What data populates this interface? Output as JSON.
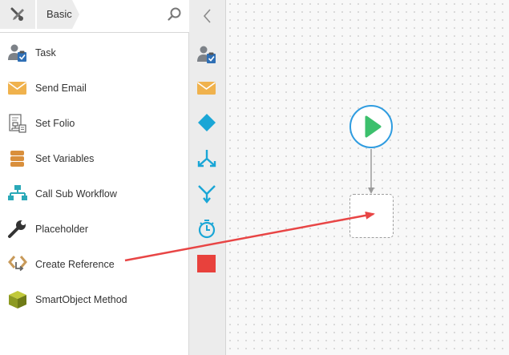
{
  "toolbox": {
    "breadcrumb_label": "Basic",
    "items": [
      {
        "label": "Task",
        "icon": "user-task-icon"
      },
      {
        "label": "Send Email",
        "icon": "envelope-icon"
      },
      {
        "label": "Set Folio",
        "icon": "set-folio-icon"
      },
      {
        "label": "Set Variables",
        "icon": "stack-icon"
      },
      {
        "label": "Call Sub Workflow",
        "icon": "hierarchy-icon"
      },
      {
        "label": "Placeholder",
        "icon": "wrench-icon"
      },
      {
        "label": "Create Reference",
        "icon": "create-reference-icon"
      },
      {
        "label": "SmartObject Method",
        "icon": "cube-icon"
      }
    ]
  },
  "colors": {
    "accent_blue": "#2f9ce0",
    "start_green": "#3cc06d",
    "stop_red": "#e8413c",
    "email_orange": "#f0b24d",
    "annotation_arrow": "#e84545"
  }
}
